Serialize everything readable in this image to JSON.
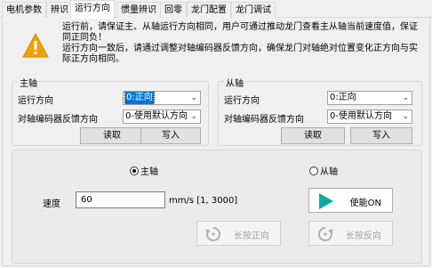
{
  "tabs": [
    {
      "label": "电机参数"
    },
    {
      "label": "辨识"
    },
    {
      "label": "运行方向"
    },
    {
      "label": "惯量辨识"
    },
    {
      "label": "回零"
    },
    {
      "label": "龙门配置"
    },
    {
      "label": "龙门调试"
    }
  ],
  "active_tab": "运行方向",
  "warning": {
    "icon": "warning-icon",
    "color": "#f0a000",
    "line1": "运行前，请保证主、从轴运行方向相同，用户可通过推动龙门查看主从轴当前速度值，保证同正同负！",
    "line2": "运行方向一致后，请通过调整对轴编码器反馈方向，确保龙门对轴绝对位置变化正方向与实际正方向相同。"
  },
  "master": {
    "title": "主轴",
    "run_dir_label": "运行方向",
    "run_dir_value": "0:正向",
    "fb_dir_label": "对轴编码器反馈方向",
    "fb_dir_value": "0-使用默认方向",
    "read_label": "读取",
    "write_label": "写入"
  },
  "slave": {
    "title": "从轴",
    "run_dir_label": "运行方向",
    "run_dir_value": "0:正向",
    "fb_dir_label": "对轴编码器反馈方向",
    "fb_dir_value": "0-使用默认方向",
    "read_label": "读取",
    "write_label": "写入"
  },
  "jog": {
    "radio_master": "主轴",
    "radio_slave": "从轴",
    "selected": "主轴",
    "speed_label": "速度",
    "speed_value": "60",
    "speed_unit": "mm/s [1, 3000]",
    "enable_label": "使能ON",
    "enable_color": "#0aa89e",
    "jog_forward_label": "长按正向",
    "jog_reverse_label": "长按反向"
  }
}
